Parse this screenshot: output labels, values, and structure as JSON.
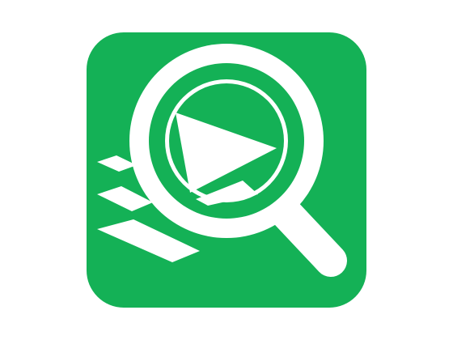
{
  "icon": {
    "name": "search-video-app-icon",
    "background_color": "#14B156",
    "foreground_color": "#FFFFFF",
    "glyphs": [
      "magnifier-icon",
      "play-icon",
      "stacked-layers-icon"
    ]
  }
}
